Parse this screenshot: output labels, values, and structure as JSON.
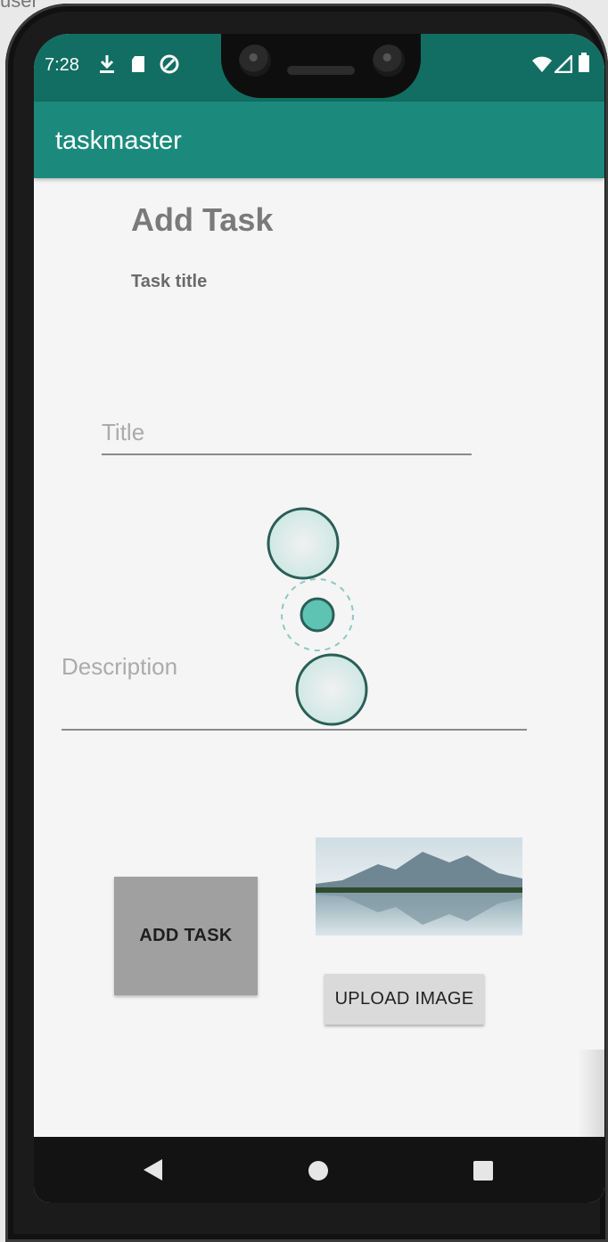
{
  "status_bar": {
    "time": "7:28",
    "icons": [
      "download-icon",
      "sd-card-icon",
      "sync-icon",
      "wifi-icon",
      "signal-icon",
      "battery-icon"
    ]
  },
  "app_bar": {
    "title": "taskmaster"
  },
  "form": {
    "heading": "Add Task",
    "task_title_label": "Task title",
    "title_placeholder": "Title",
    "description_placeholder": "Description",
    "add_button_label": "ADD TASK",
    "upload_button_label": "UPLOAD IMAGE",
    "image": "mountain-lake-image"
  },
  "nav_bar": {
    "icons": [
      "back-icon",
      "home-icon",
      "recents-icon"
    ]
  },
  "colors": {
    "status_bar": "#126e63",
    "app_bar": "#1b8a7d",
    "touch_accent": "#5fc3b4"
  }
}
